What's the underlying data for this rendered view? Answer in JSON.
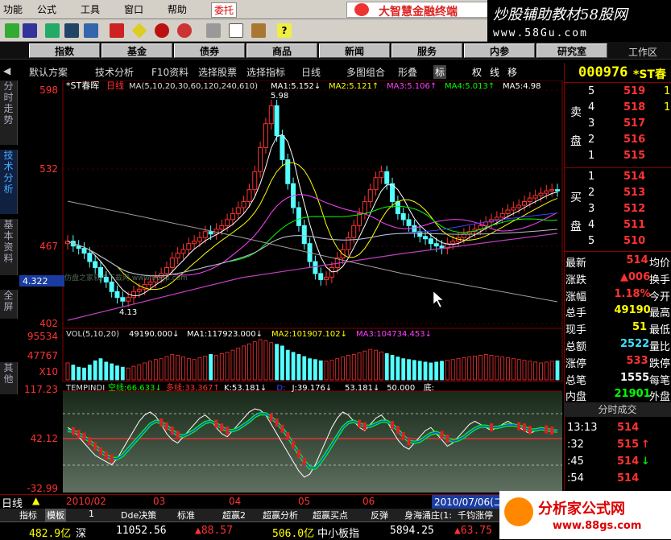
{
  "menubar": {
    "items": [
      "功能",
      "公式",
      "工具",
      "窗口",
      "帮助"
    ],
    "entrust": "委托",
    "brand": "大智慧金融终端"
  },
  "watermark": {
    "line1": "炒股辅助教材58股网",
    "line2": "www.58Gu.com"
  },
  "nav": {
    "buttons": [
      "指数",
      "基金",
      "债券",
      "商品",
      "新闻",
      "服务",
      "内参",
      "研究室"
    ],
    "workspace": "工作区"
  },
  "analysis_bar": {
    "items": [
      "默认方案",
      "技术分析",
      "F10资料",
      "选择股票",
      "选择指标",
      "日线",
      "多图组合",
      "形叠"
    ],
    "right_buttons": [
      "标",
      "权",
      "线",
      "移"
    ]
  },
  "left_tabs": [
    "分时走势",
    "技术分析",
    "基本资料",
    "全屏",
    "其他"
  ],
  "price_panel": {
    "title": "*ST春晖",
    "period": "日线",
    "ma_params": "MA(5,10,20,30,60,120,240,610)",
    "ma_values": [
      {
        "label": "MA1:",
        "value": "5.152",
        "dir": "↓",
        "color": "#ffffff"
      },
      {
        "label": "MA2:",
        "value": "5.121",
        "dir": "↑",
        "color": "#ffff00"
      },
      {
        "label": "MA3:",
        "value": "5.106",
        "dir": "↑",
        "color": "#ff40ff"
      },
      {
        "label": "MA4:",
        "value": "5.013",
        "dir": "↑",
        "color": "#00ff00"
      },
      {
        "label": "MA5:",
        "value": "4.98",
        "dir": "",
        "color": "#ffffff"
      }
    ],
    "y_labels": [
      "598",
      "532",
      "467",
      "402"
    ],
    "current_price_tag": "4.322",
    "high_label": "5.98",
    "low_label": "4.13",
    "watermark_text": "仿盘之家软件下载网 www.06gp.com"
  },
  "volume_panel": {
    "title": "VOL(5,10,20)",
    "values": [
      {
        "label": "",
        "value": "49190.000",
        "dir": "↓",
        "color": "#ffffff"
      },
      {
        "label": "MA1:",
        "value": "117923.000",
        "dir": "↓",
        "color": "#ffffff"
      },
      {
        "label": "MA2:",
        "value": "101907.102",
        "dir": "↓",
        "color": "#ffff00"
      },
      {
        "label": "MA3:",
        "value": "104734.453",
        "dir": "↓",
        "color": "#ff40ff"
      }
    ],
    "y_labels": [
      "95534",
      "47767",
      "X10"
    ]
  },
  "indicator_panel": {
    "title": "TEMPINDI",
    "values": [
      {
        "label": "空线:",
        "value": "66.633",
        "dir": "↓",
        "color": "#00ff00"
      },
      {
        "label": "多线:",
        "value": "33.367",
        "dir": "↑",
        "color": "#ff3232"
      },
      {
        "label": "K:",
        "value": "53.181",
        "dir": "↓",
        "color": "#ffffff"
      },
      {
        "label": "D:",
        "value": "",
        "dir": "",
        "color": "#4040ff"
      },
      {
        "label": "J:",
        "value": "39.176",
        "dir": "↓",
        "color": "#ffffff"
      },
      {
        "label": "",
        "value": "53.181",
        "dir": "↓",
        "color": "#ffffff"
      },
      {
        "label": "",
        "value": "50.000",
        "dir": "",
        "color": "#ffffff"
      },
      {
        "label": "底:",
        "value": "",
        "dir": "",
        "color": "#ffffff"
      }
    ],
    "y_labels": [
      "117.23",
      "42.12",
      "-32.99"
    ]
  },
  "date_bar": {
    "start": "2010/02",
    "months": [
      "03",
      "04",
      "05",
      "06"
    ],
    "current": "2010/07/06(二"
  },
  "indicator_tabs": [
    "指标",
    "模板",
    "1",
    "Dde决策",
    "标准",
    "超赢2",
    "超赢分析",
    "超赢买点",
    "反弹",
    "身海涌庄(1:",
    "千钧涨停"
  ],
  "right_panel": {
    "code": "000976",
    "name": "*ST春",
    "sell_label": "卖盘",
    "buy_label": "买盘",
    "sell_levels": [
      {
        "level": "5",
        "price": "519",
        "vol": "1"
      },
      {
        "level": "4",
        "price": "518",
        "vol": "1"
      },
      {
        "level": "3",
        "price": "517",
        "vol": ""
      },
      {
        "level": "2",
        "price": "516",
        "vol": ""
      },
      {
        "level": "1",
        "price": "515",
        "vol": ""
      }
    ],
    "buy_levels": [
      {
        "level": "1",
        "price": "514",
        "vol": ""
      },
      {
        "level": "2",
        "price": "513",
        "vol": ""
      },
      {
        "level": "3",
        "price": "512",
        "vol": ""
      },
      {
        "level": "4",
        "price": "511",
        "vol": ""
      },
      {
        "level": "5",
        "price": "510",
        "vol": ""
      }
    ],
    "quotes": [
      {
        "label": "最新",
        "value": "514",
        "extra": "均价",
        "vcolor": "#ff3232"
      },
      {
        "label": "涨跌",
        "value": "▲006",
        "extra": "换手",
        "vcolor": "#ff3232"
      },
      {
        "label": "涨幅",
        "value": "1.18%",
        "extra": "今开",
        "vcolor": "#ff3232"
      },
      {
        "label": "总手",
        "value": "49190",
        "extra": "最高",
        "vcolor": "#ffff00"
      },
      {
        "label": "现手",
        "value": "51",
        "extra": "最低",
        "vcolor": "#ffff00"
      },
      {
        "label": "总额",
        "value": "2522",
        "extra": "量比",
        "vcolor": "#40e0ff"
      },
      {
        "label": "涨停",
        "value": "533",
        "extra": "跌停",
        "vcolor": "#ff3232"
      },
      {
        "label": "总笔",
        "value": "1555",
        "extra": "每笔",
        "vcolor": "#ffffff"
      },
      {
        "label": "内盘",
        "value": "21901",
        "extra": "外盘",
        "vcolor": "#00ff00"
      }
    ],
    "ticks_title": "分时成交",
    "ticks": [
      {
        "time": "13:13",
        "price": "514",
        "dir": ""
      },
      {
        "time": ":32",
        "price": "515",
        "dir": "↑"
      },
      {
        "time": ":45",
        "price": "514",
        "dir": "↓"
      },
      {
        "time": ":54",
        "price": "514",
        "dir": ""
      }
    ]
  },
  "status_bar": {
    "items": [
      {
        "text": "482.9亿",
        "color": "#ffff00"
      },
      {
        "text": "深",
        "color": "#ffffff"
      },
      {
        "text": "11052.56",
        "color": "#ffffff"
      },
      {
        "text": "▲88.57",
        "color": "#ff3232"
      },
      {
        "text": "506.0亿",
        "color": "#ffff00"
      },
      {
        "text": "中小板指",
        "color": "#ffffff"
      },
      {
        "text": "5894.25",
        "color": "#ffffff"
      },
      {
        "text": "▲63.75",
        "color": "#ff3232"
      }
    ]
  },
  "logo_bottom": {
    "title": "分析家公式网",
    "url": "www.88gs.com"
  },
  "chart_data": {
    "type": "candlestick",
    "title": "*ST春晖 日线",
    "ylim": [
      4.02,
      5.98
    ],
    "x_range": [
      "2010/02",
      "2010/07/06"
    ],
    "price": {
      "open": [
        4.7,
        4.72,
        4.68,
        4.66,
        4.62,
        4.55,
        4.5,
        4.42,
        4.38,
        4.3,
        4.25,
        4.22,
        4.25,
        4.3,
        4.32,
        4.36,
        4.38,
        4.42,
        4.45,
        4.5,
        4.58,
        4.62,
        4.65,
        4.7,
        4.72,
        4.75,
        4.8,
        4.78,
        4.82,
        4.85,
        4.9,
        4.95,
        5.0,
        5.05,
        5.15,
        5.3,
        5.5,
        5.7,
        5.85,
        5.6,
        5.4,
        5.2,
        5.0,
        4.85,
        4.7,
        4.55,
        4.45,
        4.4,
        4.42,
        4.5,
        4.58,
        4.65,
        4.75,
        4.85,
        4.95,
        5.05,
        5.15,
        5.25,
        5.3,
        5.2,
        5.05,
        4.95,
        4.9,
        4.85,
        4.8,
        4.76,
        4.74,
        4.7,
        4.68,
        4.66,
        4.7,
        4.72,
        4.75,
        4.78,
        4.8,
        4.82,
        4.85,
        4.88,
        4.9,
        4.92,
        4.95,
        4.98,
        5.0,
        5.02,
        5.05,
        5.08,
        5.1,
        5.12,
        5.14,
        5.15
      ],
      "close": [
        4.72,
        4.68,
        4.66,
        4.62,
        4.55,
        4.5,
        4.42,
        4.38,
        4.3,
        4.25,
        4.22,
        4.25,
        4.3,
        4.32,
        4.36,
        4.38,
        4.42,
        4.45,
        4.5,
        4.58,
        4.62,
        4.65,
        4.7,
        4.72,
        4.75,
        4.8,
        4.78,
        4.82,
        4.85,
        4.9,
        4.95,
        5.0,
        5.05,
        5.15,
        5.3,
        5.5,
        5.7,
        5.85,
        5.6,
        5.4,
        5.2,
        5.0,
        4.85,
        4.7,
        4.55,
        4.45,
        4.4,
        4.42,
        4.5,
        4.58,
        4.65,
        4.75,
        4.85,
        4.95,
        5.05,
        5.15,
        5.25,
        5.3,
        5.2,
        5.05,
        4.95,
        4.9,
        4.85,
        4.8,
        4.76,
        4.74,
        4.7,
        4.68,
        4.66,
        4.7,
        4.72,
        4.75,
        4.78,
        4.8,
        4.82,
        4.85,
        4.88,
        4.9,
        4.92,
        4.95,
        4.98,
        5.0,
        5.02,
        5.05,
        5.08,
        5.1,
        5.12,
        5.14,
        5.15,
        5.14
      ]
    },
    "volume": [
      40,
      35,
      30,
      28,
      35,
      45,
      50,
      42,
      38,
      33,
      30,
      28,
      32,
      36,
      40,
      44,
      48,
      50,
      55,
      60,
      58,
      54,
      50,
      48,
      52,
      56,
      60,
      58,
      62,
      65,
      70,
      75,
      80,
      85,
      90,
      95,
      92,
      88,
      84,
      80,
      70,
      65,
      60,
      55,
      50,
      48,
      45,
      44,
      46,
      50,
      54,
      58,
      60,
      64,
      68,
      72,
      70,
      66,
      62,
      58,
      54,
      50,
      48,
      46,
      44,
      42,
      40,
      42,
      44,
      46,
      48,
      50,
      52,
      54,
      56,
      58,
      60,
      58,
      56,
      54,
      52,
      50,
      48,
      46,
      44,
      42,
      40,
      42,
      44,
      45
    ],
    "indicator": {
      "k": [
        60,
        55,
        45,
        35,
        25,
        15,
        10,
        5,
        0,
        10,
        25,
        40,
        55,
        70,
        80,
        85,
        78,
        65,
        50,
        40,
        35,
        45,
        55,
        65,
        75,
        80,
        72,
        60,
        50,
        45,
        55,
        65,
        75,
        85,
        90,
        88,
        80,
        65,
        50,
        35,
        20,
        5,
        -10,
        -20,
        -15,
        0,
        20,
        40,
        60,
        75,
        85,
        80,
        70,
        60,
        55,
        65,
        75,
        80,
        70,
        55,
        40,
        30,
        25,
        35,
        45,
        55,
        60,
        50,
        40,
        30,
        35,
        45,
        55,
        65,
        70,
        65,
        60,
        55,
        60,
        65,
        70,
        65,
        60,
        55,
        50,
        55,
        60,
        55,
        53,
        53
      ],
      "d": [
        55,
        54,
        50,
        45,
        38,
        30,
        22,
        15,
        10,
        10,
        15,
        25,
        35,
        45,
        55,
        65,
        70,
        68,
        62,
        55,
        48,
        46,
        50,
        55,
        62,
        68,
        70,
        66,
        60,
        55,
        55,
        58,
        64,
        70,
        78,
        82,
        82,
        76,
        68,
        58,
        46,
        32,
        18,
        5,
        -5,
        -5,
        5,
        18,
        32,
        46,
        60,
        68,
        70,
        66,
        62,
        62,
        66,
        70,
        70,
        64,
        56,
        46,
        38,
        36,
        38,
        44,
        50,
        52,
        48,
        42,
        38,
        40,
        45,
        52,
        58,
        62,
        62,
        60,
        60,
        62,
        64,
        64,
        62,
        60,
        56,
        56,
        58,
        57,
        55,
        54
      ]
    },
    "series_names": [
      "MA5",
      "MA10",
      "MA20",
      "MA30",
      "MA60",
      "MA120",
      "MA240",
      "MA610"
    ]
  }
}
